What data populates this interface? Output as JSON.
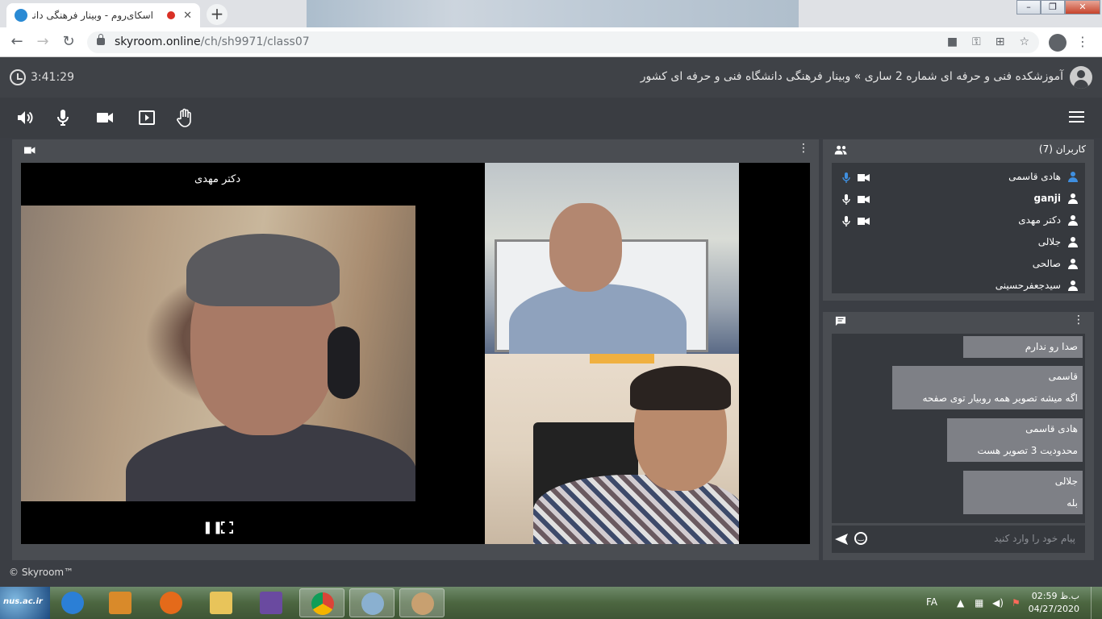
{
  "browser": {
    "tab_title": "اسکای‌روم - وبینار فرهنگی دانشگاه فنی و حرفه ای کشور",
    "tab_close": "✕",
    "new_tab": "+",
    "url_host": "skyroom.online",
    "url_path": "/ch/sh9971/class07",
    "window_controls": [
      "–",
      "❐",
      "✕"
    ]
  },
  "header": {
    "timer": "3:41:29",
    "room_title": "آموزشکده فنی و حرفه ای شماره 2 ساری » وبینار فرهنگی دانشگاه فنی و حرفه ای کشور"
  },
  "toolbar": {
    "tools": [
      "speaker-icon",
      "microphone-icon",
      "camera-icon",
      "present-icon",
      "raise-hand-icon"
    ],
    "accent_color": "#3f8fe0"
  },
  "video": {
    "speaker_name": "دکتر مهدی",
    "controls": [
      "pause-icon",
      "fullscreen-icon"
    ]
  },
  "users": {
    "title": "کاربران (7)",
    "list": [
      {
        "name": "هادی قاسمی",
        "mic": true,
        "cam": true,
        "highlight": true
      },
      {
        "name": "ganji",
        "mic": true,
        "cam": true,
        "highlight": false
      },
      {
        "name": "دکتر مهدی",
        "mic": true,
        "cam": true,
        "highlight": false
      },
      {
        "name": "جلالی",
        "mic": false,
        "cam": false,
        "highlight": false
      },
      {
        "name": "صالحی",
        "mic": false,
        "cam": false,
        "highlight": false
      },
      {
        "name": "سیدجعفرحسینی",
        "mic": false,
        "cam": false,
        "highlight": false
      }
    ]
  },
  "chat": {
    "messages": [
      {
        "sender": "",
        "text": "صدا رو ندارم"
      },
      {
        "sender": "قاسمی",
        "text": "اگه میشه تصویر همه روبیار توی صفحه"
      },
      {
        "sender": "هادی قاسمی",
        "text": "محدودیت 3 تصویر هست"
      },
      {
        "sender": "جلالی",
        "text": "بله"
      }
    ],
    "placeholder": "پیام خود را وارد کنید"
  },
  "footer": {
    "copyright": "© Skyroom™"
  },
  "taskbar": {
    "start_label": "nus.ac.ir",
    "language": "FA",
    "time": "02:59 ب.ظ",
    "date": "04/27/2020"
  }
}
